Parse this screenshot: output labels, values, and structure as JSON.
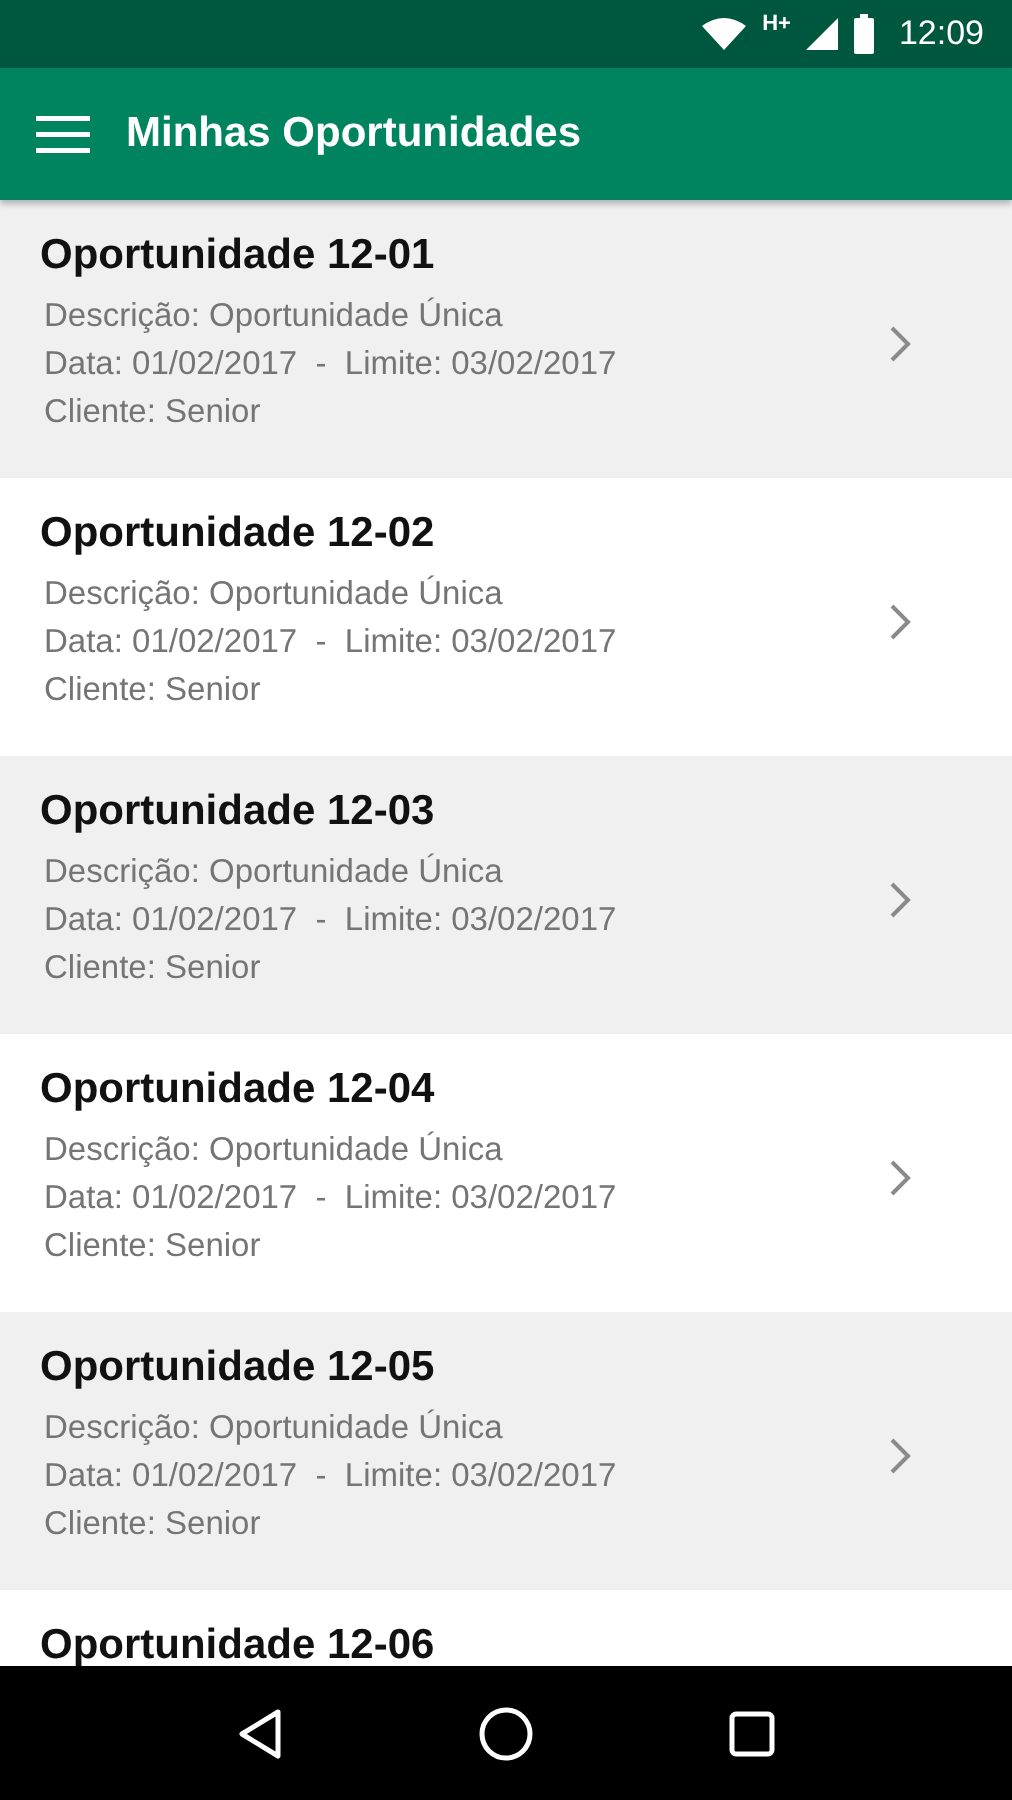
{
  "status_bar": {
    "network": "H+",
    "time": "12:09"
  },
  "app_bar": {
    "title": "Minhas Oportunidades"
  },
  "items": [
    {
      "title": "Oportunidade 12-01",
      "description": "Descrição: Oportunidade Única",
      "dates": "Data: 01/02/2017  -  Limite: 03/02/2017",
      "client": "Cliente: Senior"
    },
    {
      "title": "Oportunidade 12-02",
      "description": "Descrição: Oportunidade Única",
      "dates": "Data: 01/02/2017  -  Limite: 03/02/2017",
      "client": "Cliente: Senior"
    },
    {
      "title": "Oportunidade 12-03",
      "description": "Descrição: Oportunidade Única",
      "dates": "Data: 01/02/2017  -  Limite: 03/02/2017",
      "client": "Cliente: Senior"
    },
    {
      "title": "Oportunidade 12-04",
      "description": "Descrição: Oportunidade Única",
      "dates": "Data: 01/02/2017  -  Limite: 03/02/2017",
      "client": "Cliente: Senior"
    },
    {
      "title": "Oportunidade 12-05",
      "description": "Descrição: Oportunidade Única",
      "dates": "Data: 01/02/2017  -  Limite: 03/02/2017",
      "client": "Cliente: Senior"
    },
    {
      "title": "Oportunidade 12-06"
    }
  ]
}
